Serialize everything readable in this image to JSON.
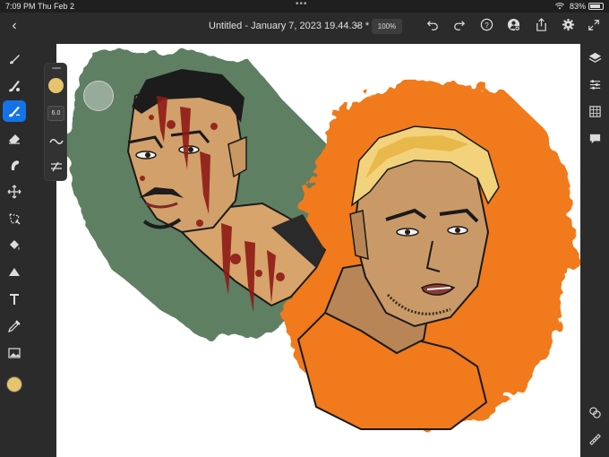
{
  "status_bar": {
    "time": "7:09 PM",
    "date": "Thu Feb 2",
    "battery": "83%"
  },
  "top_bar": {
    "title": "Untitled - January 7, 2023 19.44.38 *",
    "zoom": "100%"
  },
  "left_tools": [
    {
      "name": "brush-tool-icon"
    },
    {
      "name": "mixer-brush-icon"
    },
    {
      "name": "paint-brush-active-icon",
      "active": true
    },
    {
      "name": "eraser-icon"
    },
    {
      "name": "smudge-icon"
    },
    {
      "name": "move-icon"
    },
    {
      "name": "lasso-icon"
    },
    {
      "name": "paint-bucket-icon"
    },
    {
      "name": "shape-icon"
    },
    {
      "name": "text-icon"
    },
    {
      "name": "eyedropper-icon"
    },
    {
      "name": "image-icon"
    }
  ],
  "brush_panel": {
    "size": "6.0",
    "color": "#e6c46c"
  },
  "colors": {
    "accent": "#1473e6",
    "current_color": "#e6c46c",
    "green_wash": "#5e7f63",
    "orange_wash": "#f07a1c"
  }
}
